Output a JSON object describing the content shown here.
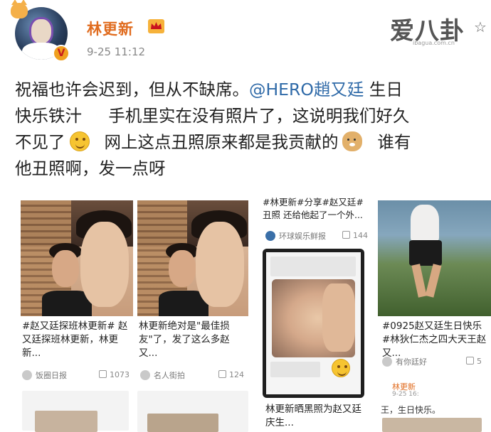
{
  "header": {
    "username": "林更新",
    "timestamp": "9-25 11:12",
    "verify_mark": "V"
  },
  "watermark": {
    "logo": "爱八卦",
    "url": "ibagua.com.cn"
  },
  "post": {
    "line1_a": "祝福也许会迟到，但从不缺席。",
    "mention": "@HERO趙又廷",
    "line1_b": " 生日",
    "line2": "快乐铁汁     手机里实在没有照片了，这说明我们好久",
    "line3_a": "不见了",
    "line3_b": "  网上这点丑照原来都是我贡献的",
    "line3_c": "  谁有",
    "line4": "他丑照啊，发一点呀"
  },
  "cards": [
    {
      "caption": "#赵又廷探班林更新# 赵又廷探班林更新，林更新...",
      "source": "饭圈日报",
      "likes": "1073"
    },
    {
      "caption": "林更新绝对是\"最佳损友\"了，发了这么多赵又...",
      "source": "名人街拍",
      "likes": "124"
    },
    {
      "caption_top": "#林更新#分享#赵又廷# 丑照 还给他起了一个外...",
      "source": "环球娱乐鲜报",
      "likes": "144",
      "caption": "林更新晒黑照为赵又廷庆生..."
    },
    {
      "caption": "#0925赵又廷生日快乐#林狄仁杰之四大天王赵又...",
      "source": "有你廷好",
      "likes": "5",
      "mini_user": "林更新",
      "mini_time": "9-25 16:",
      "mini_text": "王，生日快乐。"
    }
  ],
  "colors": {
    "username": "#e06c1f",
    "mention": "#2f6aa8",
    "timestamp": "#888888"
  },
  "icons": [
    "cat-icon",
    "crown-icon",
    "verified-icon",
    "star-icon",
    "smile-emoji-icon",
    "doge-emoji-icon",
    "like-icon",
    "source-icon"
  ]
}
